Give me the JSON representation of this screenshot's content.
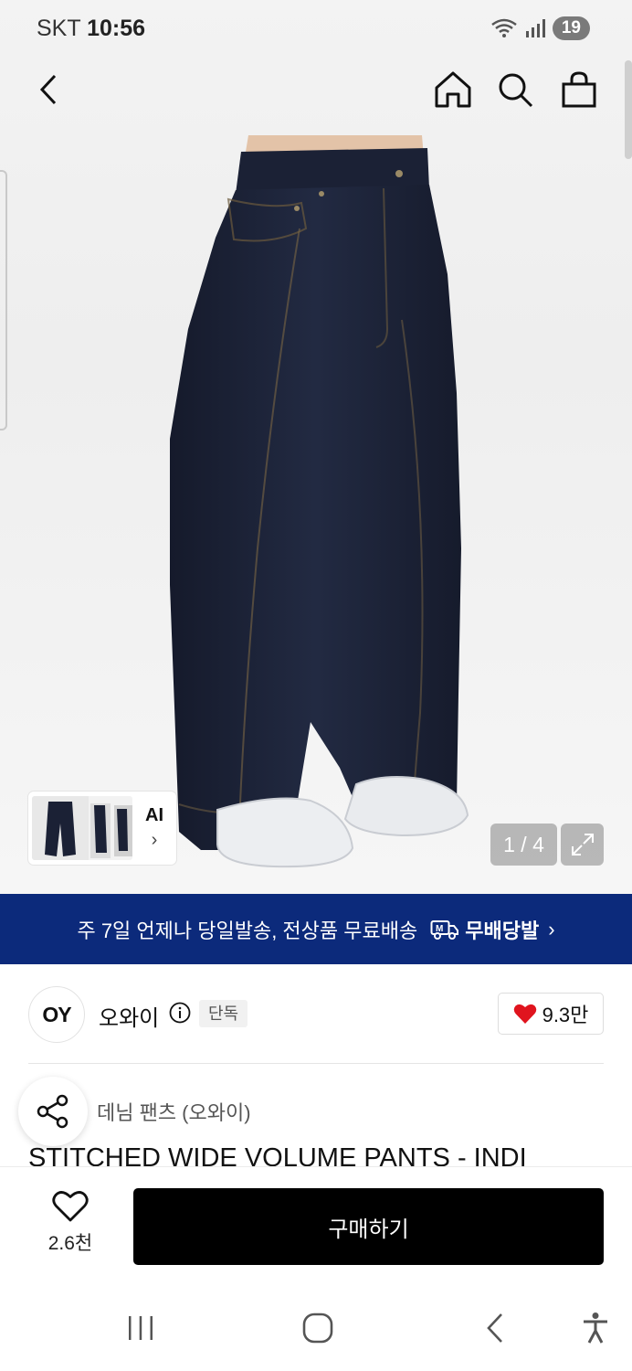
{
  "status_bar": {
    "carrier": "SKT",
    "time": "10:56",
    "battery": "19"
  },
  "gallery": {
    "counter": "1 / 4",
    "ai_label": "AI",
    "ai_arrow": "›"
  },
  "banner": {
    "text": "주 7일 언제나 당일발송, 전상품 무료배송",
    "tag_label": "무배당발",
    "chevron": "›"
  },
  "brand": {
    "logo_text": "OY",
    "name": "오와이",
    "badge": "단독",
    "likes": "9.3만"
  },
  "product": {
    "category": "데님 팬츠 (오와이)",
    "title": "STITCHED WIDE VOLUME PANTS - INDI"
  },
  "bottom": {
    "wish_count": "2.6천",
    "buy_label": "구매하기"
  },
  "colors": {
    "banner_bg": "#0c2a7b",
    "buy_bg": "#000000",
    "heart": "#e0141e",
    "denim": "#1b2135"
  },
  "icons": [
    "back-arrow-icon",
    "home-icon",
    "search-icon",
    "shopping-bag-icon",
    "expand-icon",
    "truck-icon",
    "info-icon",
    "heart-icon",
    "share-icon",
    "heart-outline-icon",
    "recent-apps-icon",
    "home-nav-icon",
    "back-nav-icon",
    "accessibility-icon"
  ]
}
